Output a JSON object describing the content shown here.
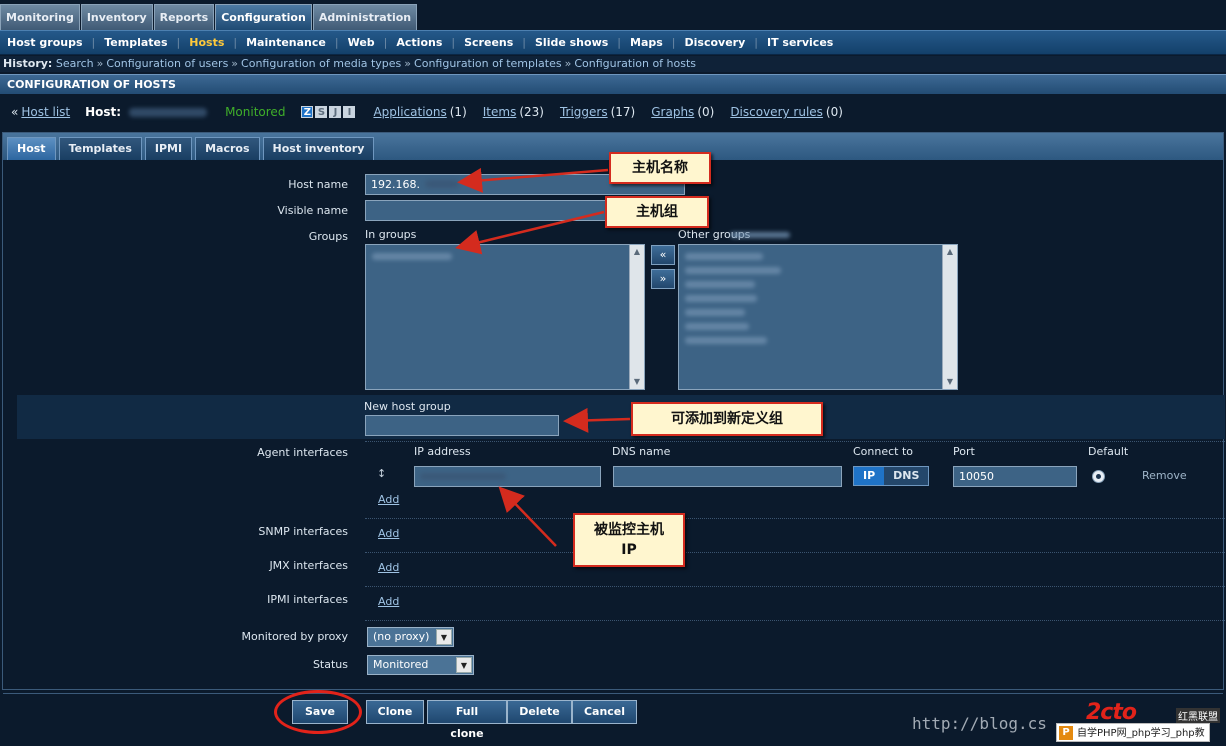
{
  "main_menu": [
    "Monitoring",
    "Inventory",
    "Reports",
    "Configuration",
    "Administration"
  ],
  "main_menu_active": "Configuration",
  "sub_menu": [
    "Host groups",
    "Templates",
    "Hosts",
    "Maintenance",
    "Web",
    "Actions",
    "Screens",
    "Slide shows",
    "Maps",
    "Discovery",
    "IT services"
  ],
  "sub_menu_active": "Hosts",
  "history": {
    "label": "History:",
    "items": [
      "Search",
      "Configuration of users",
      "Configuration of media types",
      "Configuration of templates",
      "Configuration of hosts"
    ]
  },
  "page_title": "CONFIGURATION OF HOSTS",
  "host_nav": {
    "prefix": "«",
    "host_list": "Host list",
    "host_label": "Host:",
    "status": "Monitored",
    "availability": [
      "Z",
      "S",
      "J",
      "I"
    ],
    "links": [
      {
        "label": "Applications",
        "count": "(1)"
      },
      {
        "label": "Items",
        "count": "(23)"
      },
      {
        "label": "Triggers",
        "count": "(17)"
      },
      {
        "label": "Graphs",
        "count": "(0)"
      },
      {
        "label": "Discovery rules",
        "count": "(0)"
      }
    ]
  },
  "form_tabs": [
    "Host",
    "Templates",
    "IPMI",
    "Macros",
    "Host inventory"
  ],
  "form_tabs_active": "Host",
  "form": {
    "host_name_label": "Host name",
    "host_name_value": "192.168.",
    "visible_name_label": "Visible name",
    "groups_label": "Groups",
    "in_groups_label": "In groups",
    "other_groups_label": "Other groups",
    "move_left": "«",
    "move_right": "»",
    "new_group_label": "New host group",
    "agent_interfaces_label": "Agent interfaces",
    "col_ip": "IP address",
    "col_dns": "DNS name",
    "col_connect": "Connect to",
    "col_port": "Port",
    "col_default": "Default",
    "connect_ip": "IP",
    "connect_dns": "DNS",
    "port_value": "10050",
    "remove": "Remove",
    "add": "Add",
    "snmp_label": "SNMP interfaces",
    "jmx_label": "JMX interfaces",
    "ipmi_label": "IPMI interfaces",
    "proxy_label": "Monitored by proxy",
    "proxy_value": "(no proxy)",
    "status_label": "Status",
    "status_value": "Monitored"
  },
  "buttons": {
    "save": "Save",
    "clone": "Clone",
    "full_clone": "Full clone",
    "delete": "Delete",
    "cancel": "Cancel"
  },
  "annotations": {
    "host_name": "主机名称",
    "host_group": "主机组",
    "new_group": "可添加到新定义组",
    "monitored_ip": "被监控主机IP"
  },
  "watermark": {
    "url": "http://blog.cs",
    "badge": "自学PHP网_php学习_php教",
    "badge_icon": "P",
    "logo": "2cto",
    "logo_sub": "红黑联盟"
  },
  "colors": {
    "background": "#0b1a2c",
    "active_submenu": "#ffc93a",
    "monitored": "#3fae2a",
    "callout_border": "#d42b1e",
    "callout_fill": "#fff6cf"
  }
}
